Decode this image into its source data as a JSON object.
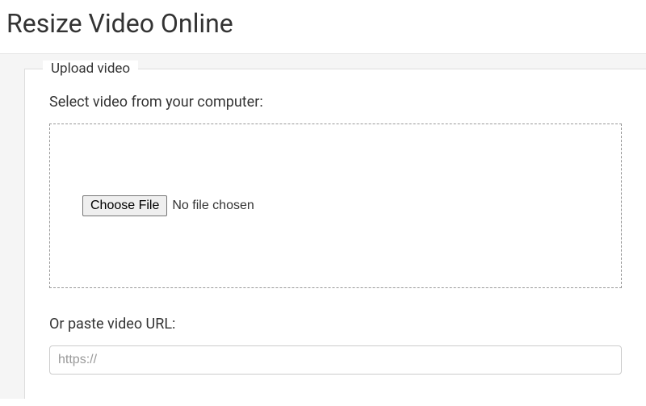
{
  "page": {
    "title": "Resize Video Online"
  },
  "upload": {
    "legend": "Upload video",
    "select_label": "Select video from your computer:",
    "choose_button": "Choose File",
    "file_status": "No file chosen",
    "url_label": "Or paste video URL:",
    "url_placeholder": "https://"
  }
}
